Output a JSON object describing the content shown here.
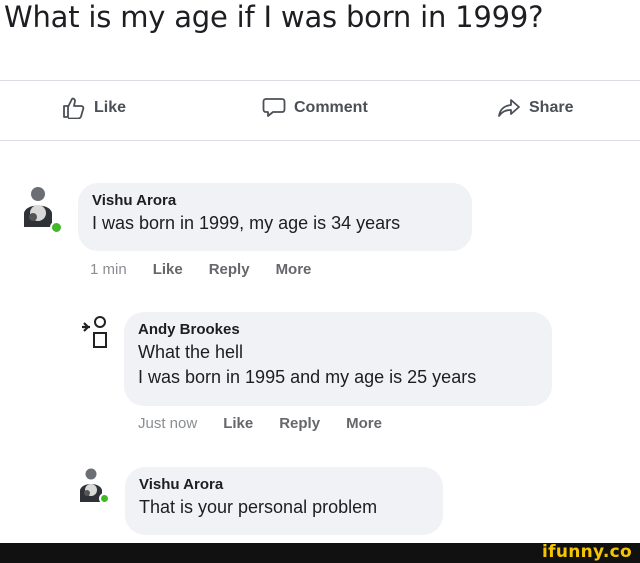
{
  "post": {
    "question": "What is my age if I was born in 1999?"
  },
  "actions": {
    "like": "Like",
    "comment": "Comment",
    "share": "Share"
  },
  "comments": [
    {
      "author": "Vishu Arora",
      "text_lines": [
        "I was born in 1999, my age is 34 years"
      ],
      "time": "1 min",
      "like": "Like",
      "reply": "Reply",
      "more": "More"
    },
    {
      "author": "Andy Brookes",
      "text_lines": [
        "What the hell",
        "I was born in 1995 and my age is 25 years"
      ],
      "time": "Just now",
      "like": "Like",
      "reply": "Reply",
      "more": "More"
    },
    {
      "author": "Vishu Arora",
      "text_lines": [
        "That is your personal problem"
      ]
    }
  ],
  "watermark": "ifunny.co",
  "colors": {
    "bubble": "#f0f2f5",
    "text": "#1c1e21",
    "meta": "#65676b",
    "online": "#42b72a",
    "brand": "#f4c500"
  }
}
